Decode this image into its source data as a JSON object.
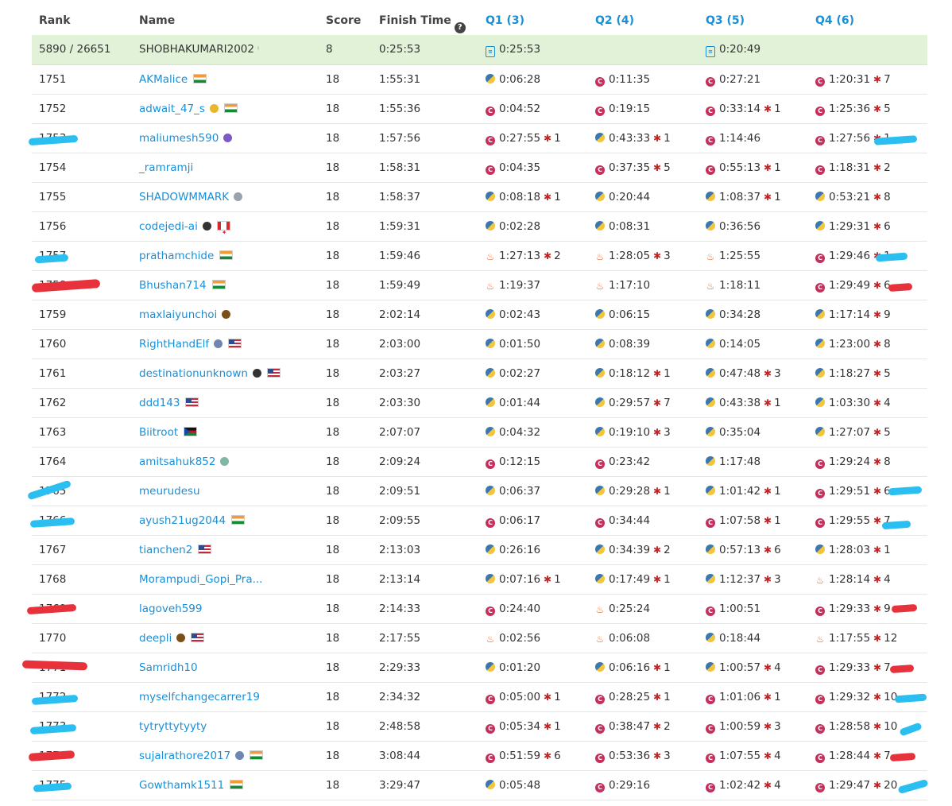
{
  "header": {
    "rank": "Rank",
    "name": "Name",
    "score": "Score",
    "finish_time": "Finish Time",
    "q1": "Q1 (3)",
    "q2": "Q2 (4)",
    "q3": "Q3 (5)",
    "q4": "Q4 (6)"
  },
  "colors": {
    "accent": "#1a8fd6",
    "highlight_row": "#e1f2d8",
    "bug": "#c02626",
    "cpp": "#c4305b"
  },
  "me": {
    "rank": "5890 / 26651",
    "name": "SHOBHAKUMARI2002",
    "score": "8",
    "finish": "0:25:53",
    "q1": "0:25:53",
    "q2": "",
    "q3": "0:20:49",
    "q4": ""
  },
  "rows": [
    {
      "rank": "1751",
      "name": "AKMalice",
      "flag": "in",
      "badge": "",
      "score": "18",
      "finish": "1:55:31",
      "q1": {
        "lang": "py",
        "t": "0:06:28",
        "b": ""
      },
      "q2": {
        "lang": "cpp",
        "t": "0:11:35",
        "b": ""
      },
      "q3": {
        "lang": "cpp",
        "t": "0:27:21",
        "b": ""
      },
      "q4": {
        "lang": "cpp",
        "t": "1:20:31",
        "b": "7"
      }
    },
    {
      "rank": "1752",
      "name": "adwait_47_s",
      "flag": "in",
      "badge": "moon",
      "score": "18",
      "finish": "1:55:36",
      "q1": {
        "lang": "cpp",
        "t": "0:04:52",
        "b": ""
      },
      "q2": {
        "lang": "cpp",
        "t": "0:19:15",
        "b": ""
      },
      "q3": {
        "lang": "cpp",
        "t": "0:33:14",
        "b": "1"
      },
      "q4": {
        "lang": "cpp",
        "t": "1:25:36",
        "b": "5"
      }
    },
    {
      "rank": "1753",
      "name": "maliumesh590",
      "flag": "",
      "badge": "purple",
      "score": "18",
      "finish": "1:57:56",
      "q1": {
        "lang": "cpp",
        "t": "0:27:55",
        "b": "1"
      },
      "q2": {
        "lang": "py",
        "t": "0:43:33",
        "b": "1"
      },
      "q3": {
        "lang": "cpp",
        "t": "1:14:46",
        "b": ""
      },
      "q4": {
        "lang": "cpp",
        "t": "1:27:56",
        "b": "1"
      }
    },
    {
      "rank": "1754",
      "name": "_ramramji",
      "flag": "",
      "badge": "",
      "score": "18",
      "finish": "1:58:31",
      "q1": {
        "lang": "cpp",
        "t": "0:04:35",
        "b": ""
      },
      "q2": {
        "lang": "cpp",
        "t": "0:37:35",
        "b": "5"
      },
      "q3": {
        "lang": "cpp",
        "t": "0:55:13",
        "b": "1"
      },
      "q4": {
        "lang": "cpp",
        "t": "1:18:31",
        "b": "2"
      }
    },
    {
      "rank": "1755",
      "name": "SHADOWMMARK",
      "flag": "",
      "badge": "gray",
      "score": "18",
      "finish": "1:58:37",
      "q1": {
        "lang": "py",
        "t": "0:08:18",
        "b": "1"
      },
      "q2": {
        "lang": "py",
        "t": "0:20:44",
        "b": ""
      },
      "q3": {
        "lang": "py",
        "t": "1:08:37",
        "b": "1"
      },
      "q4": {
        "lang": "py",
        "t": "0:53:21",
        "b": "8"
      }
    },
    {
      "rank": "1756",
      "name": "codejedi-ai",
      "flag": "ca",
      "badge": "dark",
      "score": "18",
      "finish": "1:59:31",
      "q1": {
        "lang": "py",
        "t": "0:02:28",
        "b": ""
      },
      "q2": {
        "lang": "py",
        "t": "0:08:31",
        "b": ""
      },
      "q3": {
        "lang": "py",
        "t": "0:36:56",
        "b": ""
      },
      "q4": {
        "lang": "py",
        "t": "1:29:31",
        "b": "6"
      }
    },
    {
      "rank": "1757",
      "name": "prathamchide",
      "flag": "in",
      "badge": "",
      "score": "18",
      "finish": "1:59:46",
      "q1": {
        "lang": "java",
        "t": "1:27:13",
        "b": "2"
      },
      "q2": {
        "lang": "java",
        "t": "1:28:05",
        "b": "3"
      },
      "q3": {
        "lang": "java",
        "t": "1:25:55",
        "b": ""
      },
      "q4": {
        "lang": "cpp",
        "t": "1:29:46",
        "b": "1"
      }
    },
    {
      "rank": "1758",
      "name": "Bhushan714",
      "flag": "in",
      "badge": "",
      "score": "18",
      "finish": "1:59:49",
      "q1": {
        "lang": "java",
        "t": "1:19:37",
        "b": ""
      },
      "q2": {
        "lang": "java",
        "t": "1:17:10",
        "b": ""
      },
      "q3": {
        "lang": "java",
        "t": "1:18:11",
        "b": ""
      },
      "q4": {
        "lang": "cpp",
        "t": "1:29:49",
        "b": "6"
      }
    },
    {
      "rank": "1759",
      "name": "maxlaiyunchoi",
      "flag": "",
      "badge": "brown",
      "score": "18",
      "finish": "2:02:14",
      "q1": {
        "lang": "py",
        "t": "0:02:43",
        "b": ""
      },
      "q2": {
        "lang": "py",
        "t": "0:06:15",
        "b": ""
      },
      "q3": {
        "lang": "py",
        "t": "0:34:28",
        "b": ""
      },
      "q4": {
        "lang": "py",
        "t": "1:17:14",
        "b": "9"
      }
    },
    {
      "rank": "1760",
      "name": "RightHandElf",
      "flag": "us",
      "badge": "blue",
      "score": "18",
      "finish": "2:03:00",
      "q1": {
        "lang": "py",
        "t": "0:01:50",
        "b": ""
      },
      "q2": {
        "lang": "py",
        "t": "0:08:39",
        "b": ""
      },
      "q3": {
        "lang": "py",
        "t": "0:14:05",
        "b": ""
      },
      "q4": {
        "lang": "py",
        "t": "1:23:00",
        "b": "8"
      }
    },
    {
      "rank": "1761",
      "name": "destinationunknown",
      "flag": "us",
      "badge": "dark",
      "score": "18",
      "finish": "2:03:27",
      "q1": {
        "lang": "py",
        "t": "0:02:27",
        "b": ""
      },
      "q2": {
        "lang": "py",
        "t": "0:18:12",
        "b": "1"
      },
      "q3": {
        "lang": "py",
        "t": "0:47:48",
        "b": "3"
      },
      "q4": {
        "lang": "py",
        "t": "1:18:27",
        "b": "5"
      }
    },
    {
      "rank": "1762",
      "name": "ddd143",
      "flag": "us",
      "badge": "",
      "score": "18",
      "finish": "2:03:30",
      "q1": {
        "lang": "py",
        "t": "0:01:44",
        "b": ""
      },
      "q2": {
        "lang": "py",
        "t": "0:29:57",
        "b": "7"
      },
      "q3": {
        "lang": "py",
        "t": "0:43:38",
        "b": "1"
      },
      "q4": {
        "lang": "py",
        "t": "1:03:30",
        "b": "4"
      }
    },
    {
      "rank": "1763",
      "name": "Biitroot",
      "flag": "ss",
      "badge": "",
      "score": "18",
      "finish": "2:07:07",
      "q1": {
        "lang": "py",
        "t": "0:04:32",
        "b": ""
      },
      "q2": {
        "lang": "py",
        "t": "0:19:10",
        "b": "3"
      },
      "q3": {
        "lang": "py",
        "t": "0:35:04",
        "b": ""
      },
      "q4": {
        "lang": "py",
        "t": "1:27:07",
        "b": "5"
      }
    },
    {
      "rank": "1764",
      "name": "amitsahuk852",
      "flag": "",
      "badge": "teal",
      "score": "18",
      "finish": "2:09:24",
      "q1": {
        "lang": "cpp",
        "t": "0:12:15",
        "b": ""
      },
      "q2": {
        "lang": "cpp",
        "t": "0:23:42",
        "b": ""
      },
      "q3": {
        "lang": "py",
        "t": "1:17:48",
        "b": ""
      },
      "q4": {
        "lang": "cpp",
        "t": "1:29:24",
        "b": "8"
      }
    },
    {
      "rank": "1765",
      "name": "meurudesu",
      "flag": "",
      "badge": "",
      "score": "18",
      "finish": "2:09:51",
      "q1": {
        "lang": "py",
        "t": "0:06:37",
        "b": ""
      },
      "q2": {
        "lang": "py",
        "t": "0:29:28",
        "b": "1"
      },
      "q3": {
        "lang": "py",
        "t": "1:01:42",
        "b": "1"
      },
      "q4": {
        "lang": "cpp",
        "t": "1:29:51",
        "b": "6"
      }
    },
    {
      "rank": "1766",
      "name": "ayush21ug2044",
      "flag": "in",
      "badge": "",
      "score": "18",
      "finish": "2:09:55",
      "q1": {
        "lang": "cpp",
        "t": "0:06:17",
        "b": ""
      },
      "q2": {
        "lang": "cpp",
        "t": "0:34:44",
        "b": ""
      },
      "q3": {
        "lang": "cpp",
        "t": "1:07:58",
        "b": "1"
      },
      "q4": {
        "lang": "cpp",
        "t": "1:29:55",
        "b": "7"
      }
    },
    {
      "rank": "1767",
      "name": "tianchen2",
      "flag": "us",
      "badge": "",
      "score": "18",
      "finish": "2:13:03",
      "q1": {
        "lang": "py",
        "t": "0:26:16",
        "b": ""
      },
      "q2": {
        "lang": "py",
        "t": "0:34:39",
        "b": "2"
      },
      "q3": {
        "lang": "py",
        "t": "0:57:13",
        "b": "6"
      },
      "q4": {
        "lang": "py",
        "t": "1:28:03",
        "b": "1"
      }
    },
    {
      "rank": "1768",
      "name": "Morampudi_Gopi_Pra...",
      "flag": "",
      "badge": "",
      "score": "18",
      "finish": "2:13:14",
      "q1": {
        "lang": "py",
        "t": "0:07:16",
        "b": "1"
      },
      "q2": {
        "lang": "py",
        "t": "0:17:49",
        "b": "1"
      },
      "q3": {
        "lang": "py",
        "t": "1:12:37",
        "b": "3"
      },
      "q4": {
        "lang": "java",
        "t": "1:28:14",
        "b": "4"
      }
    },
    {
      "rank": "1769",
      "name": "lagoveh599",
      "flag": "",
      "badge": "",
      "score": "18",
      "finish": "2:14:33",
      "q1": {
        "lang": "cpp",
        "t": "0:24:40",
        "b": ""
      },
      "q2": {
        "lang": "java",
        "t": "0:25:24",
        "b": ""
      },
      "q3": {
        "lang": "cpp",
        "t": "1:00:51",
        "b": ""
      },
      "q4": {
        "lang": "cpp",
        "t": "1:29:33",
        "b": "9"
      }
    },
    {
      "rank": "1770",
      "name": "deepli",
      "flag": "us",
      "badge": "brown",
      "score": "18",
      "finish": "2:17:55",
      "q1": {
        "lang": "java",
        "t": "0:02:56",
        "b": ""
      },
      "q2": {
        "lang": "java",
        "t": "0:06:08",
        "b": ""
      },
      "q3": {
        "lang": "py",
        "t": "0:18:44",
        "b": ""
      },
      "q4": {
        "lang": "java",
        "t": "1:17:55",
        "b": "12"
      }
    },
    {
      "rank": "1771",
      "name": "Samridh10",
      "flag": "",
      "badge": "",
      "score": "18",
      "finish": "2:29:33",
      "q1": {
        "lang": "py",
        "t": "0:01:20",
        "b": ""
      },
      "q2": {
        "lang": "py",
        "t": "0:06:16",
        "b": "1"
      },
      "q3": {
        "lang": "py",
        "t": "1:00:57",
        "b": "4"
      },
      "q4": {
        "lang": "cpp",
        "t": "1:29:33",
        "b": "7"
      }
    },
    {
      "rank": "1772",
      "name": "myselfchangecarrer19",
      "flag": "",
      "badge": "",
      "score": "18",
      "finish": "2:34:32",
      "q1": {
        "lang": "cpp",
        "t": "0:05:00",
        "b": "1"
      },
      "q2": {
        "lang": "cpp",
        "t": "0:28:25",
        "b": "1"
      },
      "q3": {
        "lang": "cpp",
        "t": "1:01:06",
        "b": "1"
      },
      "q4": {
        "lang": "cpp",
        "t": "1:29:32",
        "b": "10"
      }
    },
    {
      "rank": "1773",
      "name": "tytryttytyyty",
      "flag": "",
      "badge": "",
      "score": "18",
      "finish": "2:48:58",
      "q1": {
        "lang": "cpp",
        "t": "0:05:34",
        "b": "1"
      },
      "q2": {
        "lang": "cpp",
        "t": "0:38:47",
        "b": "2"
      },
      "q3": {
        "lang": "cpp",
        "t": "1:00:59",
        "b": "3"
      },
      "q4": {
        "lang": "cpp",
        "t": "1:28:58",
        "b": "10"
      }
    },
    {
      "rank": "1774",
      "name": "sujalrathore2017",
      "flag": "in",
      "badge": "blue",
      "score": "18",
      "finish": "3:08:44",
      "q1": {
        "lang": "cpp",
        "t": "0:51:59",
        "b": "6"
      },
      "q2": {
        "lang": "cpp",
        "t": "0:53:36",
        "b": "3"
      },
      "q3": {
        "lang": "cpp",
        "t": "1:07:55",
        "b": "4"
      },
      "q4": {
        "lang": "cpp",
        "t": "1:28:44",
        "b": "7"
      }
    },
    {
      "rank": "1775",
      "name": "Gowthamk1511",
      "flag": "in",
      "badge": "",
      "score": "18",
      "finish": "3:29:47",
      "q1": {
        "lang": "py",
        "t": "0:05:48",
        "b": ""
      },
      "q2": {
        "lang": "cpp",
        "t": "0:29:16",
        "b": ""
      },
      "q3": {
        "lang": "cpp",
        "t": "1:02:42",
        "b": "4"
      },
      "q4": {
        "lang": "cpp",
        "t": "1:29:47",
        "b": "20"
      }
    }
  ]
}
